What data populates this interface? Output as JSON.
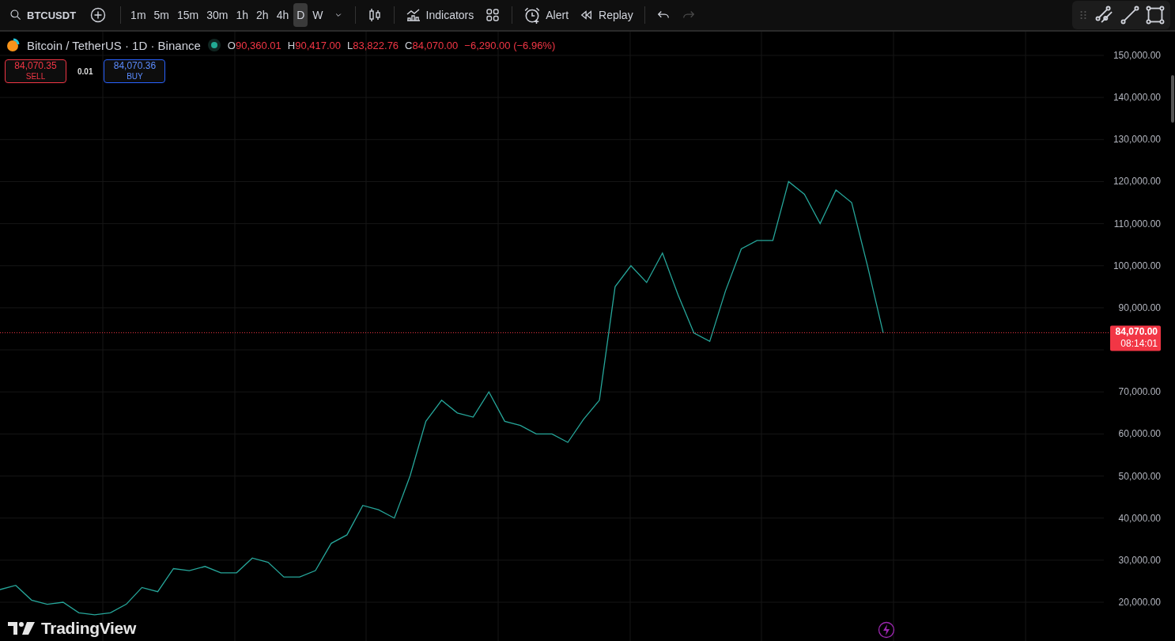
{
  "toolbar": {
    "symbol": "BTCUSDT",
    "intervals": [
      {
        "label": "1m",
        "selected": false
      },
      {
        "label": "5m",
        "selected": false
      },
      {
        "label": "15m",
        "selected": false
      },
      {
        "label": "30m",
        "selected": false
      },
      {
        "label": "1h",
        "selected": false
      },
      {
        "label": "2h",
        "selected": false
      },
      {
        "label": "4h",
        "selected": false
      },
      {
        "label": "D",
        "selected": true
      },
      {
        "label": "W",
        "selected": false
      }
    ],
    "indicators": "Indicators",
    "alert": "Alert",
    "replay": "Replay",
    "redo": {
      "disabled": true
    }
  },
  "legend": {
    "title": "Bitcoin / TetherUS · 1D · Binance",
    "ohlc": [
      {
        "label": "O",
        "value": "90,360.01"
      },
      {
        "label": "H",
        "value": "90,417.00"
      },
      {
        "label": "L",
        "value": "83,822.76"
      },
      {
        "label": "C",
        "value": "84,070.00"
      }
    ],
    "change": "−6,290.00 (−6.96%)"
  },
  "trade": {
    "sell_price": "84,070.35",
    "sell_label": "SELL",
    "spread": "0.01",
    "buy_price": "84,070.36",
    "buy_label": "BUY"
  },
  "chart": {
    "chart_data": {
      "type": "line",
      "ylim": [
        10780,
        155640
      ],
      "grid": true,
      "ref_lines": [
        {
          "axis": "y",
          "value": 84070,
          "label": "84,070.00",
          "color": "#f23645"
        }
      ],
      "yticks": [
        {
          "value": 20000,
          "label": "20,000.00"
        },
        {
          "value": 30000,
          "label": "30,000.00"
        },
        {
          "value": 40000,
          "label": "40,000.00"
        },
        {
          "value": 50000,
          "label": "50,000.00"
        },
        {
          "value": 60000,
          "label": "60,000.00"
        },
        {
          "value": 70000,
          "label": "70,000.00"
        },
        {
          "value": 90000,
          "label": "90,000.00"
        },
        {
          "value": 100000,
          "label": "100,000.00"
        },
        {
          "value": 110000,
          "label": "110,000.00"
        },
        {
          "value": 120000,
          "label": "120,000.00"
        },
        {
          "value": 130000,
          "label": "130,000.00"
        },
        {
          "value": 140000,
          "label": "140,000.00"
        },
        {
          "value": 150000,
          "label": "150,000.00"
        }
      ],
      "series": [
        {
          "color": "#26a69a",
          "values": [
            23000,
            24000,
            20500,
            19500,
            20000,
            17500,
            17000,
            17500,
            19500,
            23500,
            22500,
            28000,
            27500,
            28500,
            27000,
            27000,
            30500,
            29500,
            26000,
            26000,
            27500,
            34000,
            36000,
            43000,
            42000,
            40000,
            50000,
            63000,
            68000,
            65000,
            64000,
            70000,
            63000,
            62000,
            60000,
            60000,
            58000,
            63500,
            68000,
            95000,
            100000,
            96000,
            103000,
            93000,
            84000,
            82000,
            94000,
            104000,
            106000,
            106000,
            120000,
            117000,
            110000,
            118000,
            115000,
            100000,
            84000
          ]
        }
      ]
    },
    "countdown": "08:14:01"
  },
  "logo": {
    "text": "TradingView"
  }
}
